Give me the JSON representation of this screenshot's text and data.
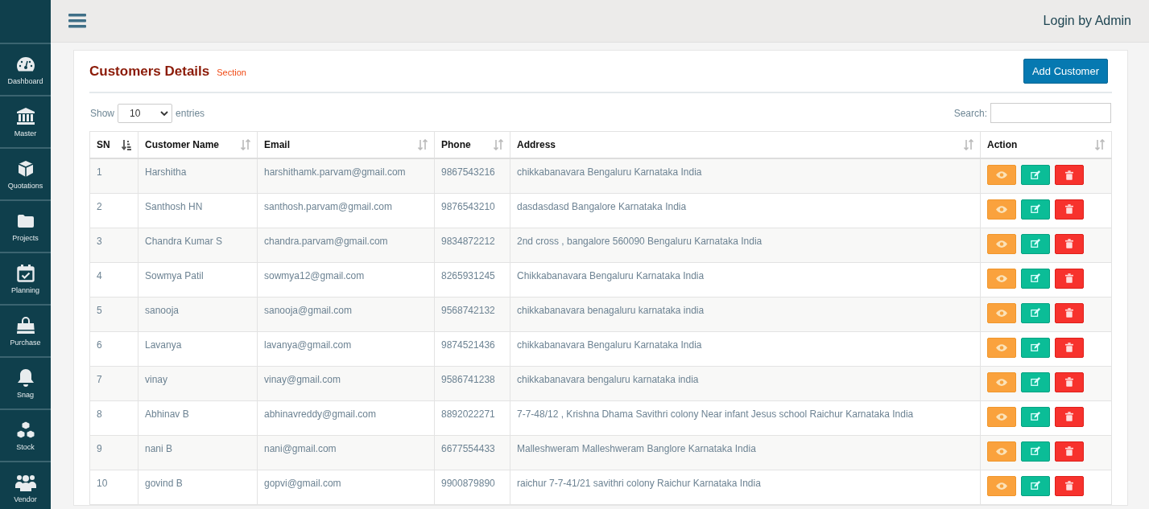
{
  "sidebar": {
    "items": [
      {
        "label": "Dashboard"
      },
      {
        "label": "Master"
      },
      {
        "label": "Quotations"
      },
      {
        "label": "Projects"
      },
      {
        "label": "Planning"
      },
      {
        "label": "Purchase"
      },
      {
        "label": "Snag"
      },
      {
        "label": "Stock"
      },
      {
        "label": "Vendor"
      }
    ]
  },
  "header": {
    "user": "Login by Admin"
  },
  "card": {
    "title": "Customers Details",
    "subtitle": "Section",
    "add_button": "Add Customer"
  },
  "length": {
    "before": "Show",
    "value": "10",
    "after": "entries"
  },
  "search": {
    "label": "Search:"
  },
  "table": {
    "columns": [
      {
        "label": "SN",
        "sorted": true
      },
      {
        "label": "Customer Name",
        "sorted": false
      },
      {
        "label": "Email",
        "sorted": false
      },
      {
        "label": "Phone",
        "sorted": false
      },
      {
        "label": "Address",
        "sorted": false
      },
      {
        "label": "Action",
        "sorted": false
      }
    ],
    "rows": [
      [
        "1",
        "Harshitha",
        "harshithamk.parvam@gmail.com",
        "9867543216",
        "chikkabanavara Bengaluru Karnataka India"
      ],
      [
        "2",
        "Santhosh HN",
        "santhosh.parvam@gmail.com",
        "9876543210",
        "dasdasdasd Bangalore Karnataka India"
      ],
      [
        "3",
        "Chandra Kumar S",
        "chandra.parvam@gmail.com",
        "9834872212",
        "2nd cross , bangalore 560090 Bengaluru Karnataka India"
      ],
      [
        "4",
        "Sowmya Patil",
        "sowmya12@gmail.com",
        "8265931245",
        "Chikkabanavara Bengaluru Karnataka India"
      ],
      [
        "5",
        "sanooja",
        "sanooja@gmail.com",
        "9568742132",
        "chikkabanavara benagaluru karnataka india"
      ],
      [
        "6",
        "Lavanya",
        "lavanya@gmail.com",
        "9874521436",
        "chikkabanavara Bengaluru Karnataka India"
      ],
      [
        "7",
        "vinay",
        "vinay@gmail.com",
        "9586741238",
        "chikkabanavara bengaluru karnataka india"
      ],
      [
        "8",
        "Abhinav B",
        "abhinavreddy@gmail.com",
        "8892022271",
        "7-7-48/12 , Krishna Dhama Savithri colony Near infant Jesus school Raichur Karnataka India"
      ],
      [
        "9",
        "nani B",
        "nani@gmail.com",
        "6677554433",
        "Malleshweram Malleshweram Banglore Karnataka India"
      ],
      [
        "10",
        "govind B",
        "gopvi@gmail.com",
        "9900879890",
        "raichur 7-7-41/21 savithri colony Raichur Karnataka India"
      ]
    ]
  }
}
